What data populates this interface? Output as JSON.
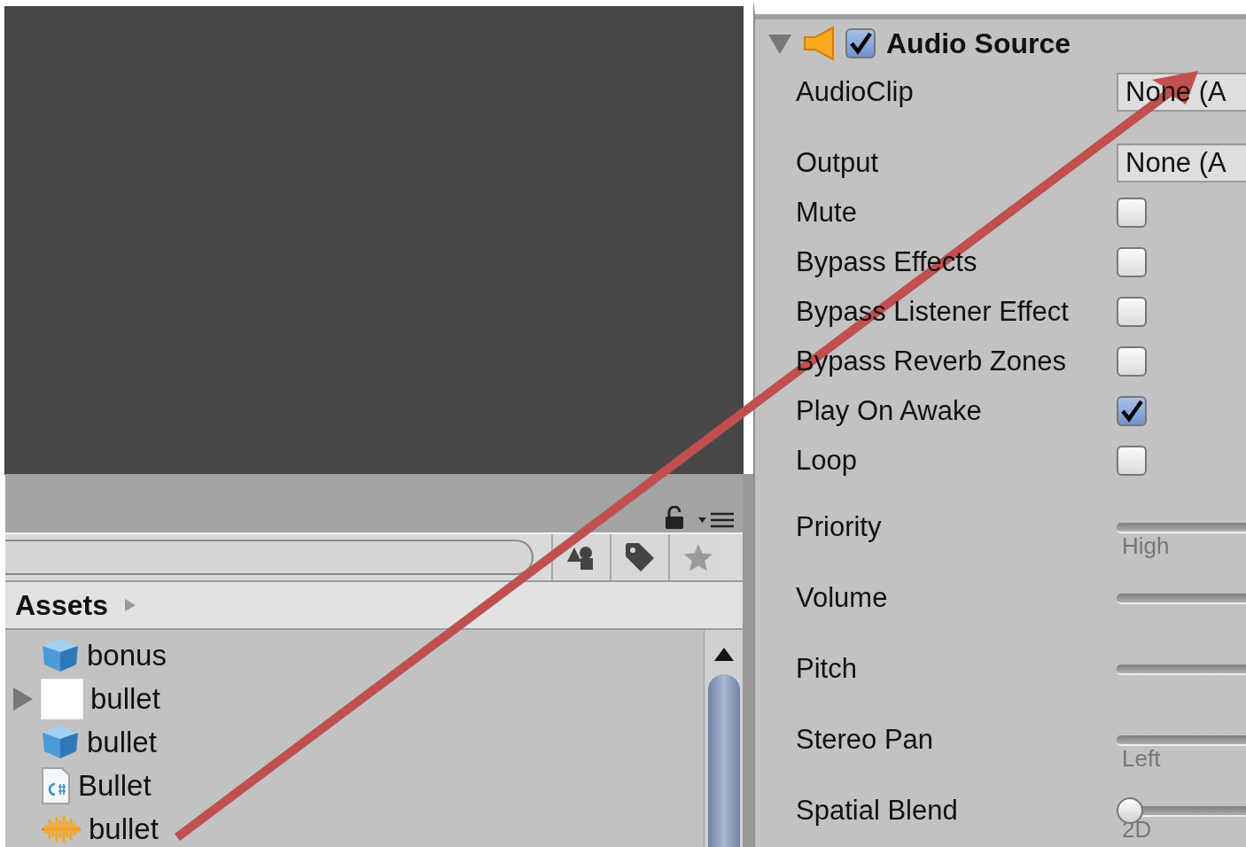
{
  "project": {
    "breadcrumb": "Assets",
    "assets": [
      {
        "name": "bonus",
        "kind": "prefab",
        "expandable": false
      },
      {
        "name": "bullet",
        "kind": "texture",
        "expandable": true
      },
      {
        "name": "bullet",
        "kind": "prefab",
        "expandable": false
      },
      {
        "name": "Bullet",
        "kind": "script",
        "expandable": false
      },
      {
        "name": "bullet",
        "kind": "audio",
        "expandable": false
      }
    ]
  },
  "inspector": {
    "component": {
      "title": "Audio Source",
      "expanded": true,
      "enabled": true
    },
    "properties": [
      {
        "label": "AudioClip",
        "kind": "object",
        "value": "None (A"
      },
      {
        "label": "Output",
        "kind": "object",
        "value": "None (A"
      },
      {
        "label": "Mute",
        "kind": "checkbox",
        "checked": false
      },
      {
        "label": "Bypass Effects",
        "kind": "checkbox",
        "checked": false
      },
      {
        "label": "Bypass Listener Effect",
        "kind": "checkbox",
        "checked": false
      },
      {
        "label": "Bypass Reverb Zones",
        "kind": "checkbox",
        "checked": false
      },
      {
        "label": "Play On Awake",
        "kind": "checkbox",
        "checked": true
      },
      {
        "label": "Loop",
        "kind": "checkbox",
        "checked": false
      },
      {
        "label": "Priority",
        "kind": "slider",
        "sublabel": "High"
      },
      {
        "label": "Volume",
        "kind": "slider"
      },
      {
        "label": "Pitch",
        "kind": "slider"
      },
      {
        "label": "Stereo Pan",
        "kind": "slider",
        "sublabel": "Left"
      },
      {
        "label": "Spatial Blend",
        "kind": "slider",
        "level": 0,
        "sublabel": "2D"
      }
    ]
  }
}
